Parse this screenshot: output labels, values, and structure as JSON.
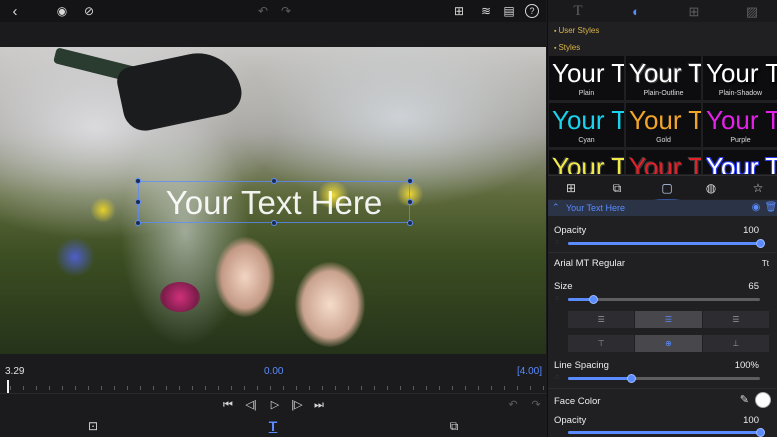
{
  "top_toolbar": {
    "back_icon": "chevron-left-icon",
    "icons": [
      "eye-preview-icon",
      "eye-hide-icon",
      "undo-icon",
      "redo-icon",
      "safe-zone-icon",
      "layers-icon",
      "media-icon",
      "help-icon"
    ],
    "help_label": "?"
  },
  "preview": {
    "overlay_text": "Your Text Here"
  },
  "timeline": {
    "current_time": "3.29",
    "position": "0.00",
    "duration": "[4.00]"
  },
  "transport": {
    "icons": [
      "skip-start-icon",
      "step-back-icon",
      "play-icon",
      "step-forward-icon",
      "skip-end-icon",
      "undo-icon",
      "redo-icon"
    ]
  },
  "bottom_toolbar": {
    "icons": [
      "fit-screen-icon",
      "text-tool-icon",
      "export-icon"
    ],
    "text_tool_label": "T"
  },
  "panel": {
    "tabs": [
      "text-tab-icon",
      "style-tab-icon",
      "layout-tab-icon",
      "image-tab-icon"
    ],
    "tab_text_label": "T",
    "user_styles_label": "User Styles",
    "styles_label": "Styles",
    "styles": [
      {
        "preview": "Your Text",
        "name": "Plain",
        "color": "#ffffff",
        "effect": "plain"
      },
      {
        "preview": "Your Text",
        "name": "Plain-Outline",
        "color": "#ffffff",
        "effect": "outline"
      },
      {
        "preview": "Your Text",
        "name": "Plain-Shadow",
        "color": "#ffffff",
        "effect": "shadow"
      },
      {
        "preview": "Your Text",
        "name": "Cyan",
        "color": "#19d3ee",
        "effect": "plain"
      },
      {
        "preview": "Your Text",
        "name": "Gold",
        "color": "#f0a52a",
        "effect": "plain"
      },
      {
        "preview": "Your Text",
        "name": "Purple",
        "color": "#e321e9",
        "effect": "plain"
      },
      {
        "preview": "Your Text",
        "name": "",
        "color": "#f1e84a",
        "effect": "outline"
      },
      {
        "preview": "Your Text",
        "name": "",
        "color": "#e3212b",
        "effect": "outline"
      },
      {
        "preview": "Your Text",
        "name": "",
        "color": "#ffffff",
        "effect": "blue-outline"
      }
    ],
    "style_actions": [
      "add-style-icon",
      "duplicate-style-icon",
      "folder-icon",
      "style-import-icon",
      "favorite-star-icon"
    ],
    "layer": {
      "name": "Your Text Here",
      "icons": [
        "visibility-eye-icon",
        "trash-icon"
      ]
    },
    "opacity": {
      "label": "Opacity",
      "value": "100",
      "fraction": 1.0
    },
    "font": {
      "name": "Arial MT Regular",
      "icon_label": "Tt"
    },
    "size": {
      "label": "Size",
      "value": "65",
      "fraction": 0.13
    },
    "alignment_horizontal": {
      "options": [
        "align-left-icon",
        "align-center-icon",
        "align-right-icon"
      ],
      "selected": 1
    },
    "alignment_vertical": {
      "options": [
        "align-top-icon",
        "align-middle-icon",
        "align-bottom-icon"
      ],
      "selected": 1
    },
    "line_spacing": {
      "label": "Line Spacing",
      "value": "100%",
      "fraction": 0.33
    },
    "face_color": {
      "label": "Face Color",
      "swatch": "#ffffff"
    },
    "face_opacity": {
      "label": "Opacity",
      "value": "100",
      "fraction": 1.0
    }
  },
  "colors": {
    "accent": "#5a8cff",
    "section_header": "#d8b24a",
    "panel_bg": "#202023"
  }
}
